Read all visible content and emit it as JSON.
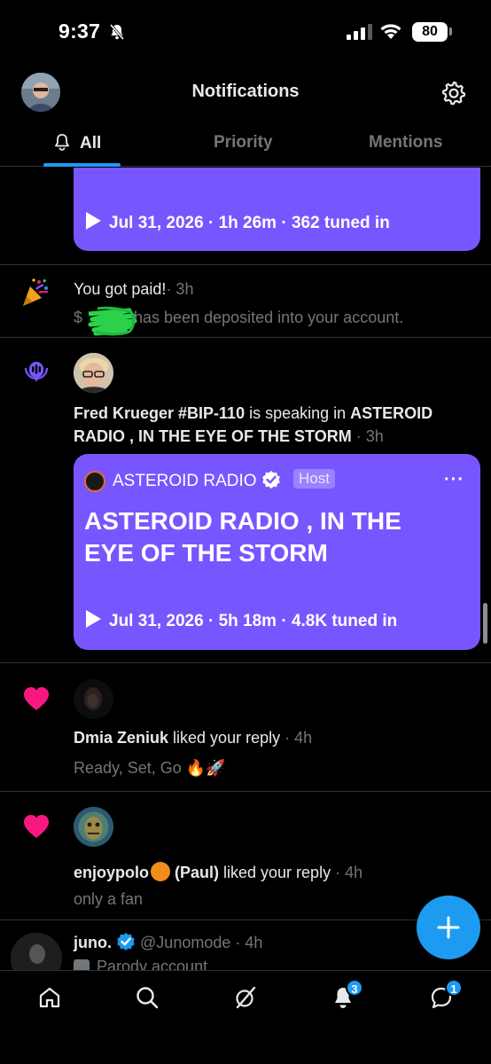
{
  "status_bar": {
    "time": "9:37",
    "battery": "80"
  },
  "header": {
    "title": "Notifications"
  },
  "tabs": [
    {
      "label": "All",
      "active": true
    },
    {
      "label": "Priority",
      "active": false
    },
    {
      "label": "Mentions",
      "active": false
    }
  ],
  "notifications": [
    {
      "type": "space",
      "space_meta": "Jul 31, 2026 · 1h 26m · 362 tuned in"
    },
    {
      "type": "payment",
      "icon": "party-popper-icon",
      "title": "You got paid!",
      "time": "· 3h",
      "amount_prefix": "$",
      "body": "has been deposited into your account."
    },
    {
      "type": "speaking",
      "icon": "spaces-mic-icon",
      "speaker": "Fred Krueger #BIP-110",
      "action": " is speaking in ",
      "space_name_1": "ASTEROID",
      "space_name_2": "RADIO , IN THE EYE OF THE STORM",
      "time": " · 3h",
      "host_name": "ASTEROID RADIO",
      "host_badge": "Host",
      "space_title": "ASTEROID RADIO , IN THE EYE OF THE STORM",
      "space_meta": "Jul 31, 2026 · 5h 18m · 4.8K tuned in"
    },
    {
      "type": "like",
      "user": "Dmia Zeniuk",
      "action": " liked your reply",
      "time": " · 4h",
      "content": "Ready, Set, Go 🔥🚀"
    },
    {
      "type": "like",
      "user_1": "enjoypolo",
      "user_2": " (Paul)",
      "action": " liked your reply",
      "time": " · 4h",
      "content": "only a fan"
    },
    {
      "type": "post",
      "name": "juno.",
      "handle": "@Junomode",
      "time": " · 4h",
      "label": "Parody account"
    }
  ],
  "bottom_nav": {
    "items": [
      "home-icon",
      "search-icon",
      "grok-icon",
      "notifications-icon",
      "messages-icon"
    ],
    "notifications_badge": "3",
    "messages_badge": "1"
  },
  "colors": {
    "accent": "#1d9bf0",
    "space_purple": "#7856ff",
    "like_pink": "#f91880",
    "text_gray": "#71767b"
  }
}
